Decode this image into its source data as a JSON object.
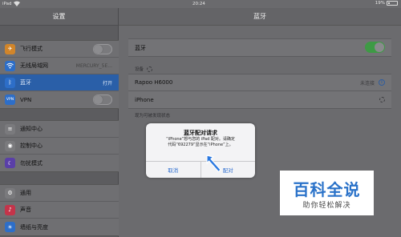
{
  "status_bar": {
    "carrier": "iPad",
    "time": "20:24",
    "battery": "19%"
  },
  "master": {
    "title": "设置",
    "groups": [
      {
        "items": [
          {
            "label": "飞行模式",
            "icon": "airplane-icon",
            "color": "#d1852a",
            "toggle": false
          },
          {
            "label": "无线局域网",
            "icon": "wifi-icon",
            "color": "#2d6ec8",
            "value": "MERCURY_5E..."
          },
          {
            "label": "蓝牙",
            "icon": "bluetooth-icon",
            "color": "#2d6ec8",
            "value": "打开",
            "selected": true
          },
          {
            "label": "VPN",
            "icon": "vpn-icon",
            "color": "#2d6ec8",
            "toggle": false
          }
        ]
      },
      {
        "items": [
          {
            "label": "通知中心",
            "icon": "notification-center-icon",
            "color": "#7a7a7d"
          },
          {
            "label": "控制中心",
            "icon": "control-center-icon",
            "color": "#7a7a7d"
          },
          {
            "label": "勿扰模式",
            "icon": "moon-icon",
            "color": "#5a3fa8"
          }
        ]
      },
      {
        "items": [
          {
            "label": "通用",
            "icon": "gear-icon",
            "color": "#7a7a7d"
          },
          {
            "label": "声音",
            "icon": "sound-icon",
            "color": "#c4344a"
          },
          {
            "label": "墙纸与亮度",
            "icon": "brightness-icon",
            "color": "#2d6ec8"
          }
        ]
      }
    ]
  },
  "detail": {
    "title": "蓝牙",
    "bluetooth_label": "蓝牙",
    "bluetooth_on": true,
    "devices_header": "设备",
    "devices": [
      {
        "name": "Rapoo H6000",
        "status": "未连接"
      },
      {
        "name": "iPhone",
        "status": ""
      }
    ],
    "discoverable_note": "现为可被发现状态"
  },
  "alert": {
    "title": "蓝牙配对请求",
    "message_line1": "“iPhone”想与您的 iPad 配对。请确定",
    "message_line2": "代码“692279”显示在“iPhone”上。",
    "cancel": "取消",
    "pair": "配对"
  },
  "watermark": {
    "brand": "百科全说",
    "slogan": "助你轻松解决"
  },
  "colors": {
    "accent": "#2f6fd0",
    "toggle_on": "#3e9a45",
    "selected_row": "#2a5fa8"
  }
}
